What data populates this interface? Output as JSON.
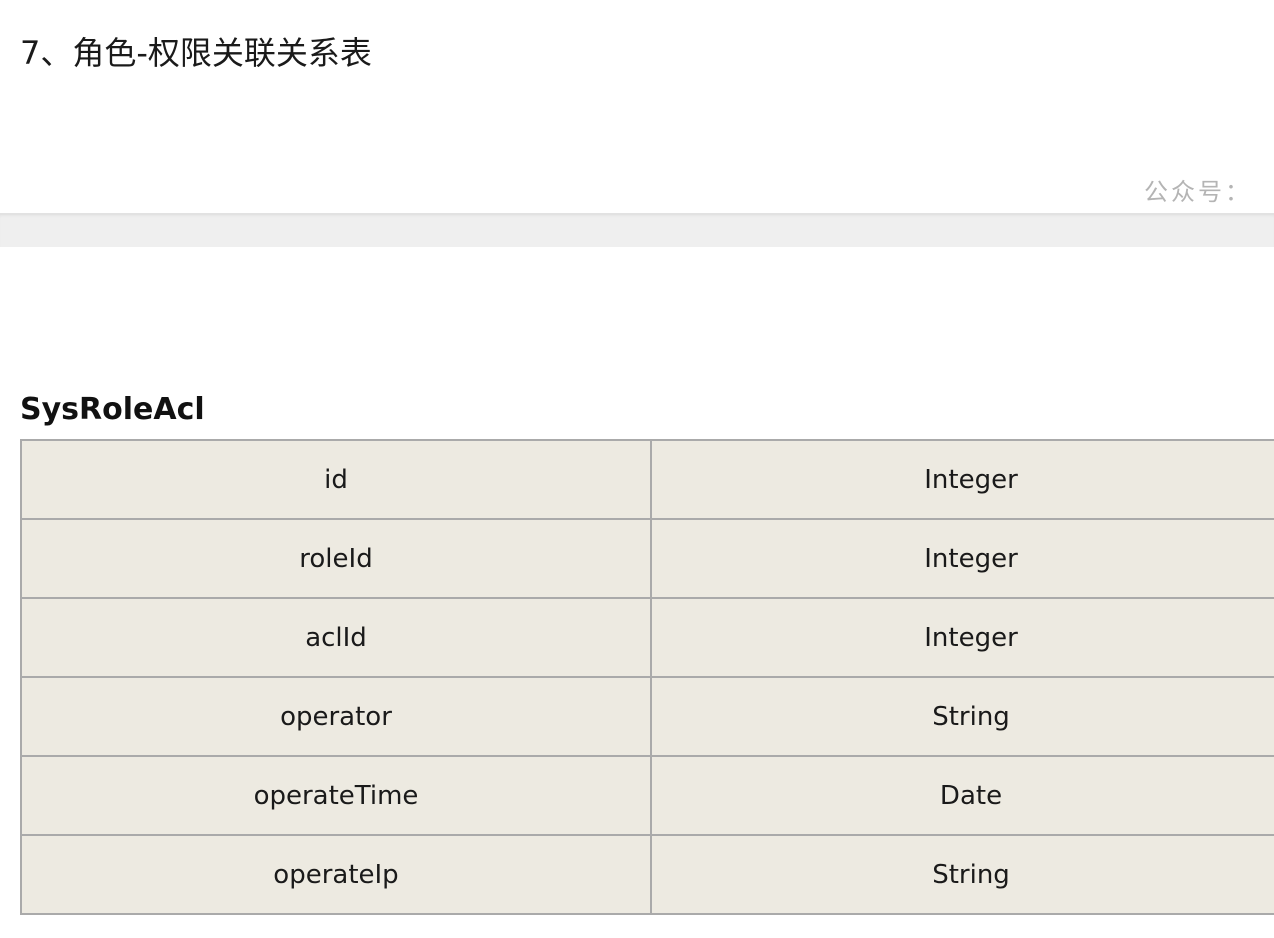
{
  "section": {
    "heading": "7、角色-权限关联关系表"
  },
  "watermark": {
    "text": "公众号："
  },
  "entity": {
    "name": "SysRoleAcl",
    "fields": [
      {
        "name": "id",
        "type": "Integer"
      },
      {
        "name": "roleId",
        "type": "Integer"
      },
      {
        "name": "aclId",
        "type": "Integer"
      },
      {
        "name": "operator",
        "type": "String"
      },
      {
        "name": "operateTime",
        "type": "Date"
      },
      {
        "name": "operateIp",
        "type": "String"
      }
    ]
  }
}
